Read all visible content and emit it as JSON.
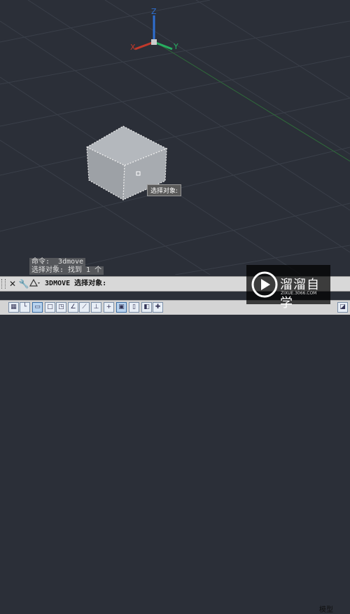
{
  "viewport": {
    "axis_labels": {
      "z": "Z",
      "y": "Y",
      "x": "X"
    },
    "tooltip": "选择对象:"
  },
  "command_history": {
    "line1": "命令: _3dmove",
    "line2": "选择对象: 找到 1 个"
  },
  "command_line": {
    "command": "3DMOVE 选择对象:"
  },
  "status_bar": {
    "model_label": "模型"
  },
  "watermark": {
    "brand": "溜溜自学",
    "url": "ZIXUE.3066.COM"
  },
  "colors": {
    "background": "#2b2f38",
    "cube": "#a4a8ad",
    "axis_x": "#c0392b",
    "axis_y": "#27ae60",
    "axis_z": "#2e6fd1"
  }
}
